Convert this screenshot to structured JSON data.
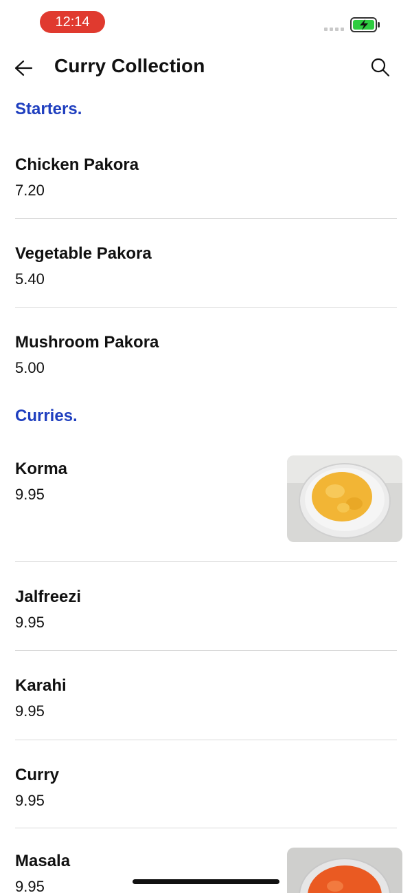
{
  "status": {
    "time": "12:14"
  },
  "header": {
    "title": "Curry Collection"
  },
  "sections": {
    "starters": {
      "title": "Starters.",
      "items": [
        {
          "name": "Chicken Pakora",
          "price": "7.20"
        },
        {
          "name": "Vegetable Pakora",
          "price": "5.40"
        },
        {
          "name": "Mushroom Pakora",
          "price": "5.00"
        }
      ]
    },
    "curries": {
      "title": "Curries.",
      "items": [
        {
          "name": "Korma",
          "price": "9.95",
          "image": "korma-photo"
        },
        {
          "name": "Jalfreezi",
          "price": "9.95"
        },
        {
          "name": "Karahi",
          "price": "9.95"
        },
        {
          "name": "Curry",
          "price": "9.95"
        },
        {
          "name": "Masala",
          "price": "9.95",
          "image": "masala-photo"
        }
      ]
    }
  },
  "colors": {
    "accent": "#1f3fbf",
    "time_pill": "#e03a2f",
    "battery": "#2ecc40"
  },
  "icons": [
    "back-arrow-icon",
    "search-icon",
    "battery-icon",
    "signal-icon"
  ]
}
